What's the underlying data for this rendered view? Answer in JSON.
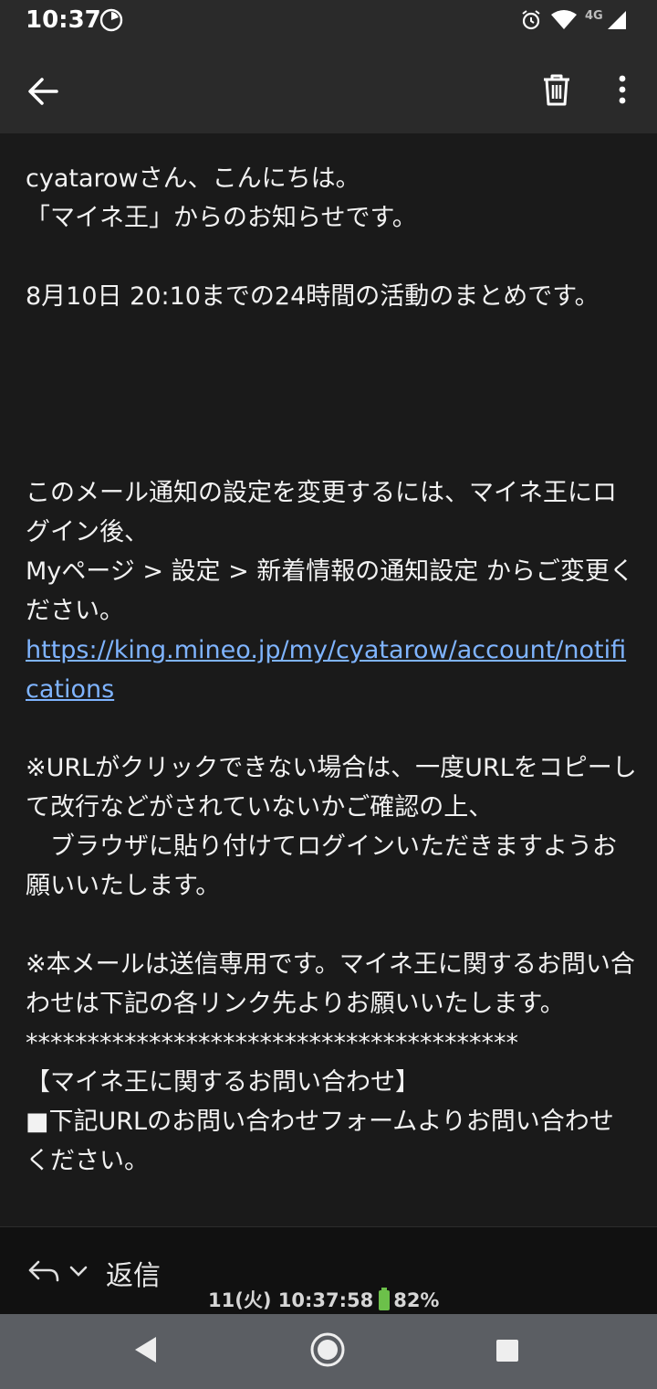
{
  "status_bar": {
    "time": "10:37",
    "network": "4G",
    "icons": [
      "alarm-icon",
      "wifi-icon",
      "signal-icon",
      "timer-icon"
    ]
  },
  "app_bar": {
    "back_icon": "arrow-left-icon",
    "delete_icon": "trash-icon",
    "more_icon": "more-vert-icon"
  },
  "email": {
    "greeting": "cyatarowさん、こんにちは。",
    "intro": "「マイネ王」からのお知らせです。",
    "summary": "8月10日 20:10までの24時間の活動のまとめです。",
    "settings_line1": "このメール通知の設定を変更するには、マイネ王にログイン後、",
    "settings_line2": "Myページ > 設定 > 新着情報の通知設定 からご変更ください。",
    "settings_link": "https://king.mineo.jp/my/cyatarow/account/notifications",
    "url_note_line1": "※URLがクリックできない場合は、一度URLをコピーして改行などがされていないかご確認の上、",
    "url_note_line2": "　ブラウザに貼り付けてログインいただきますようお願いいたします。",
    "sendonly_note": "※本メールは送信専用です。マイネ王に関するお問い合わせは下記の各リンク先よりお願いいたします。",
    "separator": "****************************************",
    "contact_heading": "【マイネ王に関するお問い合わせ】",
    "contact_line": "■下記URLのお問い合わせフォームよりお問い合わせください。"
  },
  "bottom_bar": {
    "reply_label": "返信",
    "clock_text": "11(火) 10:37:58",
    "battery_percent": "82%"
  },
  "nav_bar": {
    "icons": [
      "nav-back-icon",
      "nav-home-icon",
      "nav-recents-icon"
    ]
  },
  "colors": {
    "background": "#1a1a1a",
    "bars": "#2a2a2a",
    "link": "#7fb4ff",
    "navbar": "#5b5e63"
  }
}
